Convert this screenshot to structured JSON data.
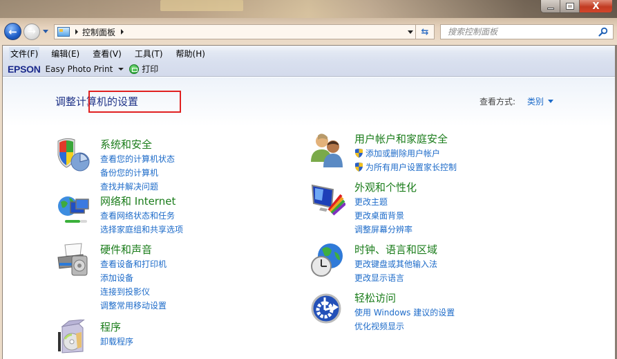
{
  "window": {
    "controls": {
      "minimize": "minimize",
      "maximize": "maximize",
      "close": "X"
    }
  },
  "nav": {
    "back_icon": "back-arrow-icon",
    "forward_icon": "forward-arrow-icon",
    "breadcrumb": [
      "控制面板"
    ],
    "search_placeholder": "搜索控制面板",
    "refresh_glyph": "⇆"
  },
  "menubar": {
    "items": [
      "文件(F)",
      "编辑(E)",
      "查看(V)",
      "工具(T)",
      "帮助(H)"
    ]
  },
  "toolbar": {
    "brand": "EPSON",
    "app": "Easy Photo Print",
    "print_label": "打印"
  },
  "main": {
    "title": "调整计算机的设置",
    "view_by_label": "查看方式:",
    "view_by_value": "类别",
    "categories_left": [
      {
        "icon": "shield-security-icon",
        "title": "系统和安全",
        "highlighted": true,
        "links": [
          {
            "text": "查看您的计算机状态"
          },
          {
            "text": "备份您的计算机"
          },
          {
            "text": "查找并解决问题"
          }
        ]
      },
      {
        "icon": "network-globe-icon",
        "title": "网络和 Internet",
        "links": [
          {
            "text": "查看网络状态和任务"
          },
          {
            "text": "选择家庭组和共享选项"
          }
        ]
      },
      {
        "icon": "printer-speaker-icon",
        "title": "硬件和声音",
        "links": [
          {
            "text": "查看设备和打印机"
          },
          {
            "text": "添加设备"
          },
          {
            "text": "连接到投影仪"
          },
          {
            "text": "调整常用移动设置"
          }
        ]
      },
      {
        "icon": "program-box-icon",
        "title": "程序",
        "links": [
          {
            "text": "卸载程序"
          }
        ]
      }
    ],
    "categories_right": [
      {
        "icon": "users-icon",
        "title": "用户帐户和家庭安全",
        "links": [
          {
            "text": "添加或删除用户帐户",
            "uac": true
          },
          {
            "text": "为所有用户设置家长控制",
            "uac": true
          }
        ]
      },
      {
        "icon": "display-palette-icon",
        "title": "外观和个性化",
        "links": [
          {
            "text": "更改主题"
          },
          {
            "text": "更改桌面背景"
          },
          {
            "text": "调整屏幕分辨率"
          }
        ]
      },
      {
        "icon": "clock-globe-icon",
        "title": "时钟、语言和区域",
        "links": [
          {
            "text": "更改键盘或其他输入法"
          },
          {
            "text": "更改显示语言"
          }
        ]
      },
      {
        "icon": "ease-of-access-icon",
        "title": "轻松访问",
        "links": [
          {
            "text": "使用 Windows 建议的设置"
          },
          {
            "text": "优化视频显示"
          }
        ]
      }
    ]
  },
  "colors": {
    "category_title": "#1a7c1a",
    "link": "#1d6bc9",
    "page_title": "#1e3287",
    "highlight_box": "#e02020",
    "epson_brand": "#1b2a8c"
  }
}
